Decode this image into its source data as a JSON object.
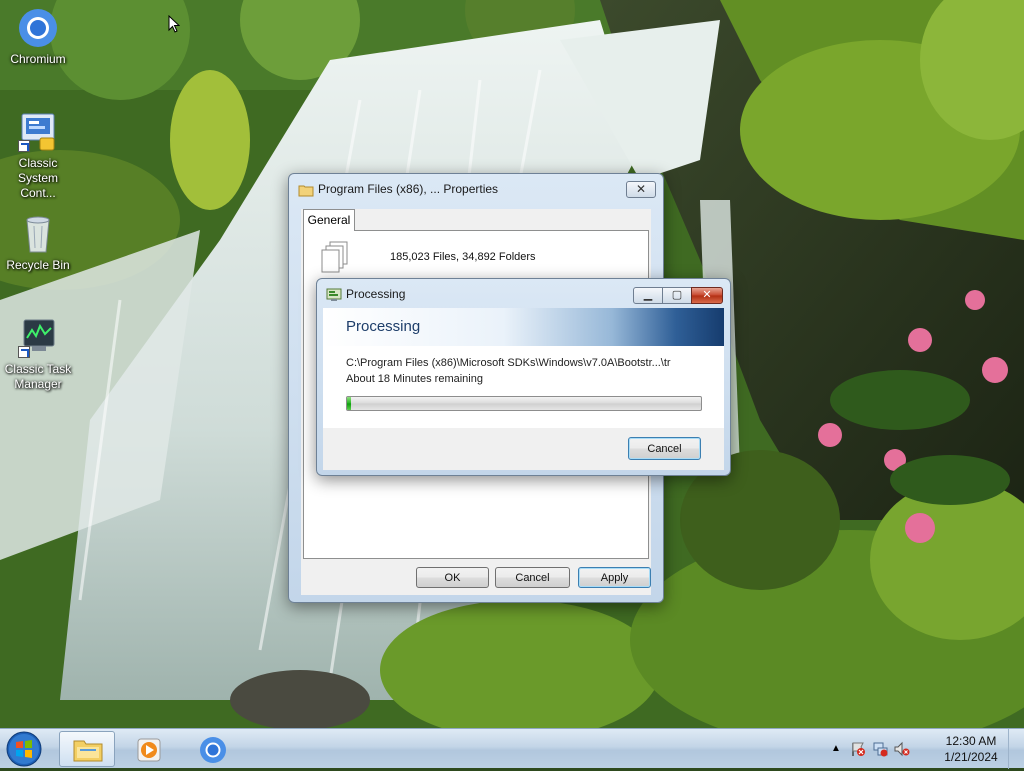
{
  "desktop": {
    "icons": [
      {
        "label": "Chromium",
        "icon": "chromium-icon"
      },
      {
        "label": "Classic System Cont...",
        "label_line1": "Classic",
        "label_line2": "System Cont...",
        "icon": "control-panel-icon"
      },
      {
        "label": "Recycle Bin",
        "icon": "recycle-bin-icon"
      },
      {
        "label": "Classic Task Manager",
        "label_line1": "Classic Task",
        "label_line2": "Manager",
        "icon": "task-manager-icon"
      }
    ]
  },
  "properties_window": {
    "title": "Program Files (x86), ... Properties",
    "tab_general": "General",
    "files_summary": "185,023 Files, 34,892 Folders",
    "ok_label": "OK",
    "cancel_label": "Cancel",
    "apply_label": "Apply"
  },
  "processing_window": {
    "title": "Processing",
    "header": "Processing",
    "current_path": "C:\\Program Files (x86)\\Microsoft SDKs\\Windows\\v7.0A\\Bootstr...\\tr",
    "time_remaining": "About 18 Minutes remaining",
    "progress_fraction": 0.01,
    "cancel_label": "Cancel"
  },
  "taskbar": {
    "pinned": [
      "start-orb-icon",
      "file-explorer-icon",
      "media-player-icon",
      "chromium-icon"
    ],
    "tray_icons": [
      "show-hidden-icons-chevron",
      "action-center-flag-icon",
      "network-icon",
      "volume-muted-icon"
    ],
    "time": "12:30 AM",
    "date": "1/21/2024"
  },
  "colors": {
    "accent_header": "#163c6e",
    "progress_green": "#23b321",
    "close_red": "#c7462b"
  }
}
